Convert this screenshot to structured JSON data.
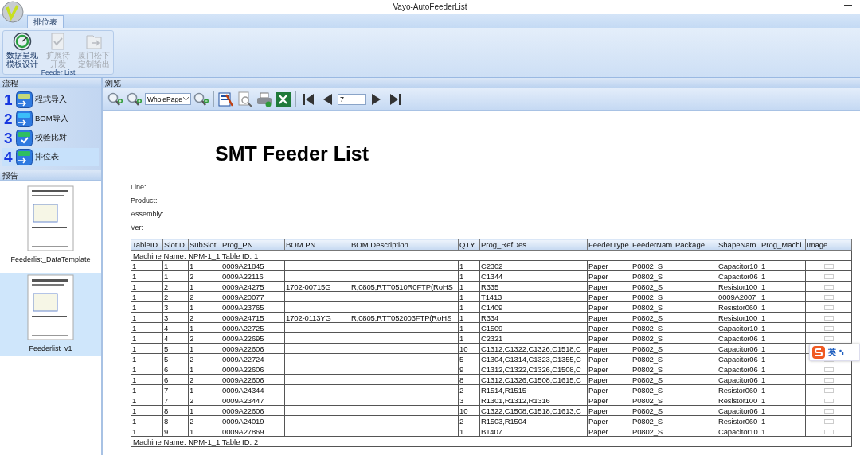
{
  "window": {
    "title": "Vayo-AutoFeederList"
  },
  "ribbon": {
    "tabs": [
      {
        "label": "排位表",
        "selected": true
      }
    ],
    "group": {
      "label": "Feeder List",
      "buttons": [
        {
          "kind": "design",
          "lines": [
            "数据呈现",
            "模板设计"
          ],
          "disabled": false
        },
        {
          "kind": "check",
          "lines": [
            "扩展待",
            "开发"
          ],
          "disabled": true
        },
        {
          "kind": "export",
          "lines": [
            "厦门松下",
            "定制输出"
          ],
          "disabled": true
        }
      ]
    }
  },
  "flow": {
    "title": "流程",
    "steps": [
      {
        "number": "1",
        "kind": "prog",
        "label": "程式导入",
        "selected": false
      },
      {
        "number": "2",
        "kind": "bom",
        "label": "BOM导入",
        "selected": false
      },
      {
        "number": "3",
        "kind": "validate",
        "label": "校验比对",
        "selected": false
      },
      {
        "number": "4",
        "kind": "feeder",
        "label": "排位表",
        "selected": true
      }
    ]
  },
  "reports": {
    "title": "报告",
    "items": [
      {
        "name": "Feederlist_DataTemplate",
        "selected": false
      },
      {
        "name": "Feederlist_v1",
        "selected": true
      }
    ]
  },
  "preview": {
    "title": "浏览",
    "zoom_mode": "WholePage",
    "page": "7",
    "report": {
      "title": "SMT Feeder List",
      "fields": [
        "Line:",
        "Product:",
        "Assembly:",
        "Ver:"
      ],
      "columns": [
        "TableID",
        "SlotID",
        "SubSlot",
        "Prog_PN",
        "BOM PN",
        "BOM Description",
        "QTY",
        "Prog_RefDes",
        "FeederType",
        "FeederNam",
        "Package",
        "ShapeNam",
        "Prog_Machi",
        "Image"
      ],
      "rows": [
        {
          "kind": "group",
          "text": "Machine Name:  NPM-1_1 Table ID: 1"
        },
        {
          "kind": "data",
          "cells": [
            "1",
            "1",
            "1",
            "0009A21845",
            "",
            "",
            "1",
            "C2302",
            "Paper",
            "P0802_S",
            "",
            "Capacitor10",
            "1"
          ]
        },
        {
          "kind": "data",
          "cells": [
            "1",
            "1",
            "2",
            "0009A22116",
            "",
            "",
            "1",
            "C1344",
            "Paper",
            "P0802_S",
            "",
            "Capacitor06",
            "1"
          ]
        },
        {
          "kind": "data",
          "cells": [
            "1",
            "2",
            "1",
            "0009A24275",
            "1702-00715G",
            "R,0805,RTT0510R0FTP(RoHS",
            "1",
            "R335",
            "Paper",
            "P0802_S",
            "",
            "Resistor100",
            "1"
          ]
        },
        {
          "kind": "data",
          "cells": [
            "1",
            "2",
            "2",
            "0009A20077",
            "",
            "",
            "1",
            "T1413",
            "Paper",
            "P0802_S",
            "",
            "0009A2007",
            "1"
          ]
        },
        {
          "kind": "data",
          "cells": [
            "1",
            "3",
            "1",
            "0009A23765",
            "",
            "",
            "1",
            "C1409",
            "Paper",
            "P0802_S",
            "",
            "Resistor060",
            "1"
          ]
        },
        {
          "kind": "data",
          "cells": [
            "1",
            "3",
            "2",
            "0009A24715",
            "1702-0113YG",
            "R,0805,RTT052003FTP(RoHS",
            "1",
            "R334",
            "Paper",
            "P0802_S",
            "",
            "Resistor100",
            "1"
          ]
        },
        {
          "kind": "data",
          "cells": [
            "1",
            "4",
            "1",
            "0009A22725",
            "",
            "",
            "1",
            "C1509",
            "Paper",
            "P0802_S",
            "",
            "Capacitor10",
            "1"
          ]
        },
        {
          "kind": "data",
          "cells": [
            "1",
            "4",
            "2",
            "0009A22695",
            "",
            "",
            "1",
            "C2321",
            "Paper",
            "P0802_S",
            "",
            "Capacitor06",
            "1"
          ]
        },
        {
          "kind": "data",
          "cells": [
            "1",
            "5",
            "1",
            "0009A22606",
            "",
            "",
            "10",
            "C1312,C1322,C1326,C1518,C",
            "Paper",
            "P0802_S",
            "",
            "Capacitor06",
            "1"
          ]
        },
        {
          "kind": "data",
          "cells": [
            "1",
            "5",
            "2",
            "0009A22724",
            "",
            "",
            "5",
            "C1304,C1314,C1323,C1355,C",
            "Paper",
            "P0802_S",
            "",
            "Capacitor06",
            "1"
          ]
        },
        {
          "kind": "data",
          "cells": [
            "1",
            "6",
            "1",
            "0009A22606",
            "",
            "",
            "9",
            "C1312,C1322,C1326,C1508,C",
            "Paper",
            "P0802_S",
            "",
            "Capacitor06",
            "1"
          ]
        },
        {
          "kind": "data",
          "cells": [
            "1",
            "6",
            "2",
            "0009A22606",
            "",
            "",
            "8",
            "C1312,C1326,C1508,C1615,C",
            "Paper",
            "P0802_S",
            "",
            "Capacitor06",
            "1"
          ]
        },
        {
          "kind": "data",
          "cells": [
            "1",
            "7",
            "1",
            "0009A24344",
            "",
            "",
            "2",
            "R1514,R1515",
            "Paper",
            "P0802_S",
            "",
            "Resistor060",
            "1"
          ]
        },
        {
          "kind": "data",
          "cells": [
            "1",
            "7",
            "2",
            "0009A23447",
            "",
            "",
            "3",
            "R1301,R1312,R1316",
            "Paper",
            "P0802_S",
            "",
            "Resistor100",
            "1"
          ]
        },
        {
          "kind": "data",
          "cells": [
            "1",
            "8",
            "1",
            "0009A22606",
            "",
            "",
            "10",
            "C1322,C1508,C1518,C1613,C",
            "Paper",
            "P0802_S",
            "",
            "Capacitor06",
            "1"
          ]
        },
        {
          "kind": "data",
          "cells": [
            "1",
            "8",
            "2",
            "0009A24019",
            "",
            "",
            "2",
            "R1503,R1504",
            "Paper",
            "P0802_S",
            "",
            "Resistor060",
            "1"
          ]
        },
        {
          "kind": "data",
          "cells": [
            "1",
            "9",
            "1",
            "0009A27869",
            "",
            "",
            "1",
            "B1407",
            "Paper",
            "P0802_S",
            "",
            "Capacitor10",
            "1"
          ]
        },
        {
          "kind": "group",
          "text": "Machine Name:  NPM-1_1 Table ID: 2"
        }
      ]
    }
  },
  "ime": {
    "label": "英"
  }
}
